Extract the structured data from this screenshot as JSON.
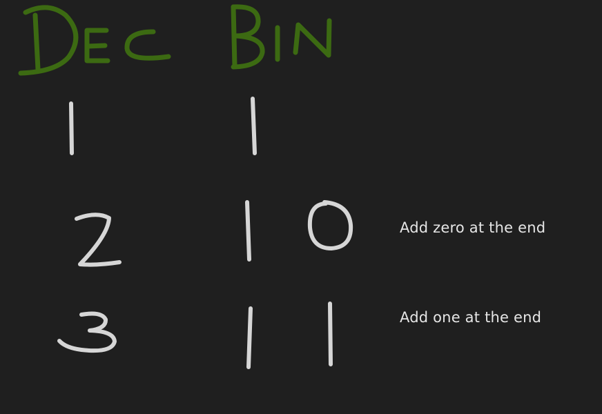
{
  "headers": {
    "dec": "Dec",
    "bin": "Bin"
  },
  "rows": [
    {
      "dec": "1",
      "bin": "1",
      "note": ""
    },
    {
      "dec": "2",
      "bin": "10",
      "note": "Add zero at the end"
    },
    {
      "dec": "3",
      "bin": "11",
      "note": "Add one at the end"
    }
  ],
  "colors": {
    "background": "#1f1f1f",
    "header_ink": "#3c6a12",
    "digit_ink": "#d6d6d6",
    "note_text": "#e6e6e6"
  }
}
